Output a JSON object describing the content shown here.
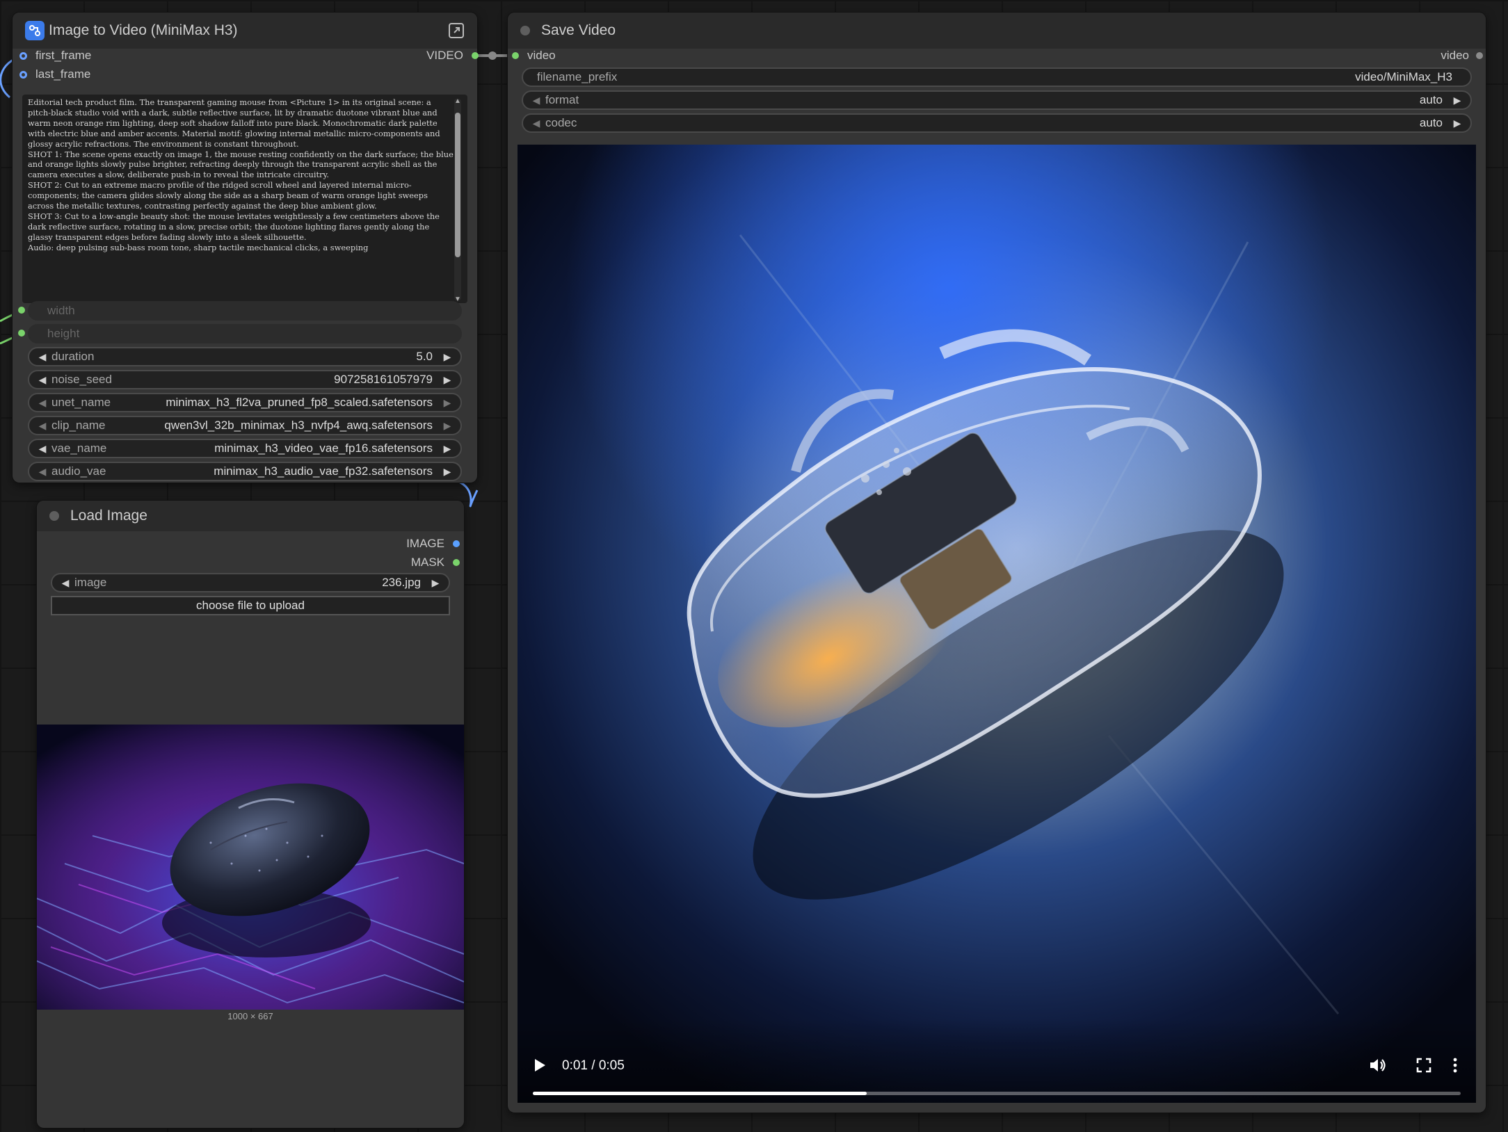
{
  "i2v_node": {
    "title": "Image to Video (MiniMax H3)",
    "inputs": [
      "first_frame",
      "last_frame"
    ],
    "output": "VIDEO",
    "prompt": "Editorial tech product film. The transparent gaming mouse from <Picture 1> in its original scene: a pitch-black studio void with a dark, subtle reflective surface, lit by dramatic duotone vibrant blue and warm neon orange rim lighting, deep soft shadow falloff into pure black. Monochromatic dark palette with electric blue and amber accents. Material motif: glowing internal metallic micro-components and glossy acrylic refractions. The environment is constant throughout.\nSHOT 1: The scene opens exactly on image 1, the mouse resting confidently on the dark surface; the blue and orange lights slowly pulse brighter, refracting deeply through the transparent acrylic shell as the camera executes a slow, deliberate push-in to reveal the intricate circuitry.\nSHOT 2: Cut to an extreme macro profile of the ridged scroll wheel and layered internal micro-components; the camera glides slowly along the side as a sharp beam of warm orange light sweeps across the metallic textures, contrasting perfectly against the deep blue ambient glow.\nSHOT 3: Cut to a low-angle beauty shot: the mouse levitates weightlessly a few centimeters above the dark reflective surface, rotating in a slow, precise orbit; the duotone lighting flares gently along the glassy transparent edges before fading slowly into a sleek silhouette.\nAudio: deep pulsing sub-bass room tone, sharp tactile mechanical clicks, a sweeping",
    "disabled_widgets": [
      "width",
      "height"
    ],
    "widgets": [
      {
        "label": "duration",
        "value": "5.0"
      },
      {
        "label": "noise_seed",
        "value": "907258161057979"
      },
      {
        "label": "unet_name",
        "value": "minimax_h3_fl2va_pruned_fp8_scaled.safetensors"
      },
      {
        "label": "clip_name",
        "value": "qwen3vl_32b_minimax_h3_nvfp4_awq.safetensors"
      },
      {
        "label": "vae_name",
        "value": "minimax_h3_video_vae_fp16.safetensors"
      },
      {
        "label": "audio_vae",
        "value": "minimax_h3_audio_vae_fp32.safetensors"
      }
    ]
  },
  "load_image_node": {
    "title": "Load Image",
    "outputs": [
      "IMAGE",
      "MASK"
    ],
    "image_widget": {
      "label": "image",
      "value": "236.jpg"
    },
    "upload_label": "choose file to upload",
    "image_size": "1000 × 667"
  },
  "save_video_node": {
    "title": "Save Video",
    "input": "video",
    "output": "video",
    "widgets": [
      {
        "label": "filename_prefix",
        "value": "video/MiniMax_H3"
      },
      {
        "label": "format",
        "value": "auto"
      },
      {
        "label": "codec",
        "value": "auto"
      }
    ],
    "player": {
      "time": "0:01 / 0:05",
      "progress": 0.36
    }
  },
  "colors": {
    "accent_blue": "#5aa0ff",
    "slot_green": "#7ad36b",
    "node_bg": "#353535"
  }
}
